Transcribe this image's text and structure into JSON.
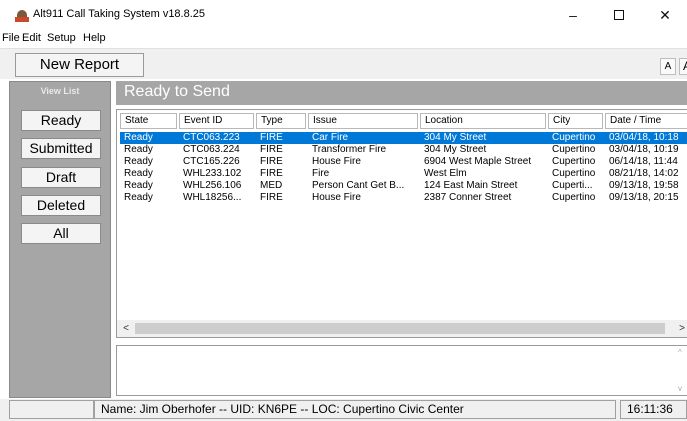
{
  "window": {
    "title": "Alt911 Call Taking System v18.8.25",
    "minimize": "–",
    "close": "✕"
  },
  "menu": [
    "File",
    "Edit",
    "Setup",
    "Help"
  ],
  "toolbar": {
    "new_report_label": "New Report",
    "font_small_label": "A",
    "font_large_label": "A"
  },
  "sidebar": {
    "title": "View List",
    "items": [
      {
        "label": "Ready"
      },
      {
        "label": "Submitted"
      },
      {
        "label": "Draft"
      },
      {
        "label": "Deleted"
      },
      {
        "label": "All"
      }
    ]
  },
  "main": {
    "title": "Ready to Send"
  },
  "table": {
    "columns": [
      "State",
      "Event ID",
      "Type",
      "Issue",
      "Location",
      "City",
      "Date / Time"
    ],
    "rows": [
      {
        "state": "Ready",
        "event_id": "CTC063.223",
        "type": "FIRE",
        "issue": "Car Fire",
        "location": "304 My Street",
        "city": "Cupertino",
        "datetime": "03/04/18, 10:18",
        "selected": true
      },
      {
        "state": "Ready",
        "event_id": "CTC063.224",
        "type": "FIRE",
        "issue": "Transformer Fire",
        "location": "304 My Street",
        "city": "Cupertino",
        "datetime": "03/04/18, 10:19",
        "selected": false
      },
      {
        "state": "Ready",
        "event_id": "CTC165.226",
        "type": "FIRE",
        "issue": "House Fire",
        "location": "6904 West Maple Street",
        "city": "Cupertino",
        "datetime": "06/14/18, 11:44",
        "selected": false
      },
      {
        "state": "Ready",
        "event_id": "WHL233.102",
        "type": "FIRE",
        "issue": "Fire",
        "location": "West Elm",
        "city": "Cupertino",
        "datetime": "08/21/18, 14:02",
        "selected": false
      },
      {
        "state": "Ready",
        "event_id": "WHL256.106",
        "type": "MED",
        "issue": "Person Cant Get B...",
        "location": "124 East Main Street",
        "city": "Cuperti...",
        "datetime": "09/13/18, 19:58",
        "selected": false
      },
      {
        "state": "Ready",
        "event_id": "WHL18256...",
        "type": "FIRE",
        "issue": "House Fire",
        "location": "2387 Conner Street",
        "city": "Cupertino",
        "datetime": "09/13/18, 20:15",
        "selected": false
      }
    ]
  },
  "scroll": {
    "left_arrow": "<",
    "right_arrow": ">",
    "up_arrow": "^",
    "down_arrow": "v"
  },
  "status": {
    "text": "Name: Jim Oberhofer -- UID: KN6PE -- LOC: Cupertino Civic Center",
    "time": "16:11:36"
  },
  "colors": {
    "selection": "#0078d7",
    "panel_gray": "#a6a6a6"
  }
}
